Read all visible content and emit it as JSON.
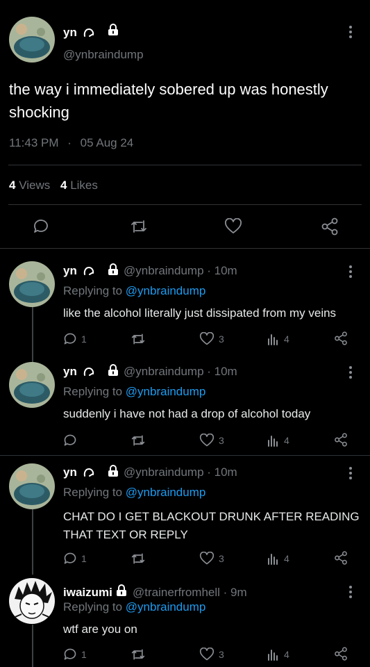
{
  "main_tweet": {
    "name": "yn",
    "handle": "@ynbraindump",
    "text": "the way i immediately sobered up was honestly shocking",
    "time": "11:43 PM",
    "date": "05 Aug 24",
    "separator": "·",
    "views_count": "4",
    "views_label": "Views",
    "likes_count": "4",
    "likes_label": "Likes"
  },
  "replies": [
    {
      "name": "yn",
      "handle": "@ynbraindump · 10m",
      "replying_label": "Replying to",
      "replying_handle": "@ynbraindump",
      "text": "like the alcohol literally just dissipated from my veins",
      "reply_count": "1",
      "like_count": "3",
      "views_count": "4"
    },
    {
      "name": "yn",
      "handle": "@ynbraindump · 10m",
      "replying_label": "Replying to",
      "replying_handle": "@ynbraindump",
      "text": "suddenly i have not had a drop of alcohol today",
      "reply_count": "",
      "like_count": "3",
      "views_count": "4"
    },
    {
      "name": "yn",
      "handle": "@ynbraindump · 10m",
      "replying_label": "Replying to",
      "replying_handle": "@ynbraindump",
      "text_line1": "CHAT DO I GET BLACKOUT DRUNK AFTER READING",
      "text_line2": "THAT TEXT OR REPLY",
      "reply_count": "1",
      "like_count": "3",
      "views_count": "4"
    },
    {
      "name": "iwaizumi",
      "handle": "@trainerfromhell · 9m",
      "replying_label": "Replying to",
      "replying_handle": "@ynbraindump",
      "text": "wtf are you on",
      "reply_count": "1",
      "like_count": "3",
      "views_count": "4"
    }
  ],
  "colors": {
    "background": "#000000",
    "accent": "#1d9bf0",
    "muted": "#71767b",
    "divider": "#2f3336"
  },
  "icons": [
    "lock-icon",
    "more-icon",
    "reply-icon",
    "retweet-icon",
    "like-icon",
    "views-icon",
    "share-icon",
    "glyph-icon"
  ]
}
